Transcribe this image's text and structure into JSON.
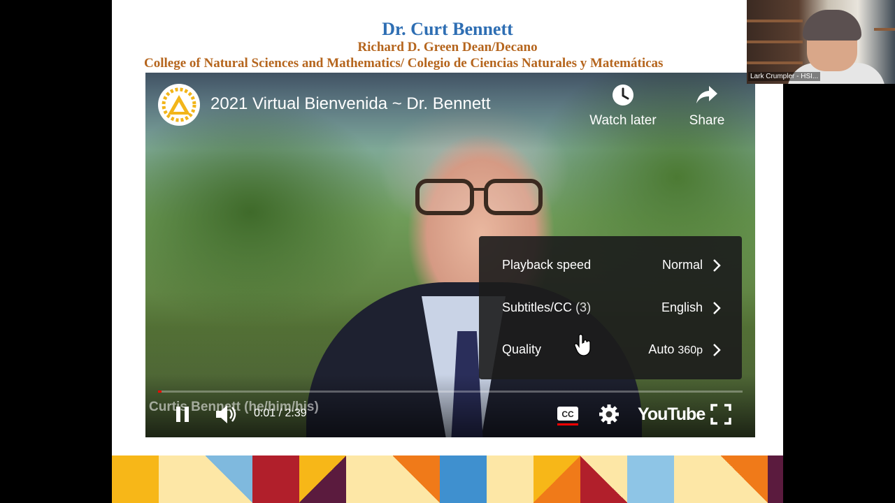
{
  "slide": {
    "title_name": "Dr. Curt Bennett",
    "title_role": "Richard D. Green Dean/Decano",
    "title_college": "College of Natural Sciences and Mathematics/ Colegio de Ciencias Naturales y Matemáticas"
  },
  "video": {
    "title": "2021 Virtual Bienvenida ~ Dr. Bennett",
    "watch_later": "Watch later",
    "share": "Share",
    "speaker_caption": "Curtis Bennett (he/him/his)",
    "time": "0:01 / 2:39",
    "progress_fraction": 0.006,
    "youtube_logo": "YouTube",
    "settings_menu": [
      {
        "label": "Playback speed",
        "value": "Normal"
      },
      {
        "label": "Subtitles/CC",
        "count": "(3)",
        "value": "English"
      },
      {
        "label": "Quality",
        "value": "Auto",
        "value_detail": "360p"
      }
    ],
    "icons": [
      "clock-icon",
      "share-arrow-icon",
      "pause-icon",
      "volume-icon",
      "cc-icon",
      "gear-icon",
      "fullscreen-icon",
      "hand-cursor-icon"
    ]
  },
  "webcam": {
    "participant": "Lark Crumpler - HSI..."
  },
  "colors": {
    "title_blue": "#2e6eb3",
    "title_orange": "#b5651d",
    "progress_red": "#ff0000"
  }
}
